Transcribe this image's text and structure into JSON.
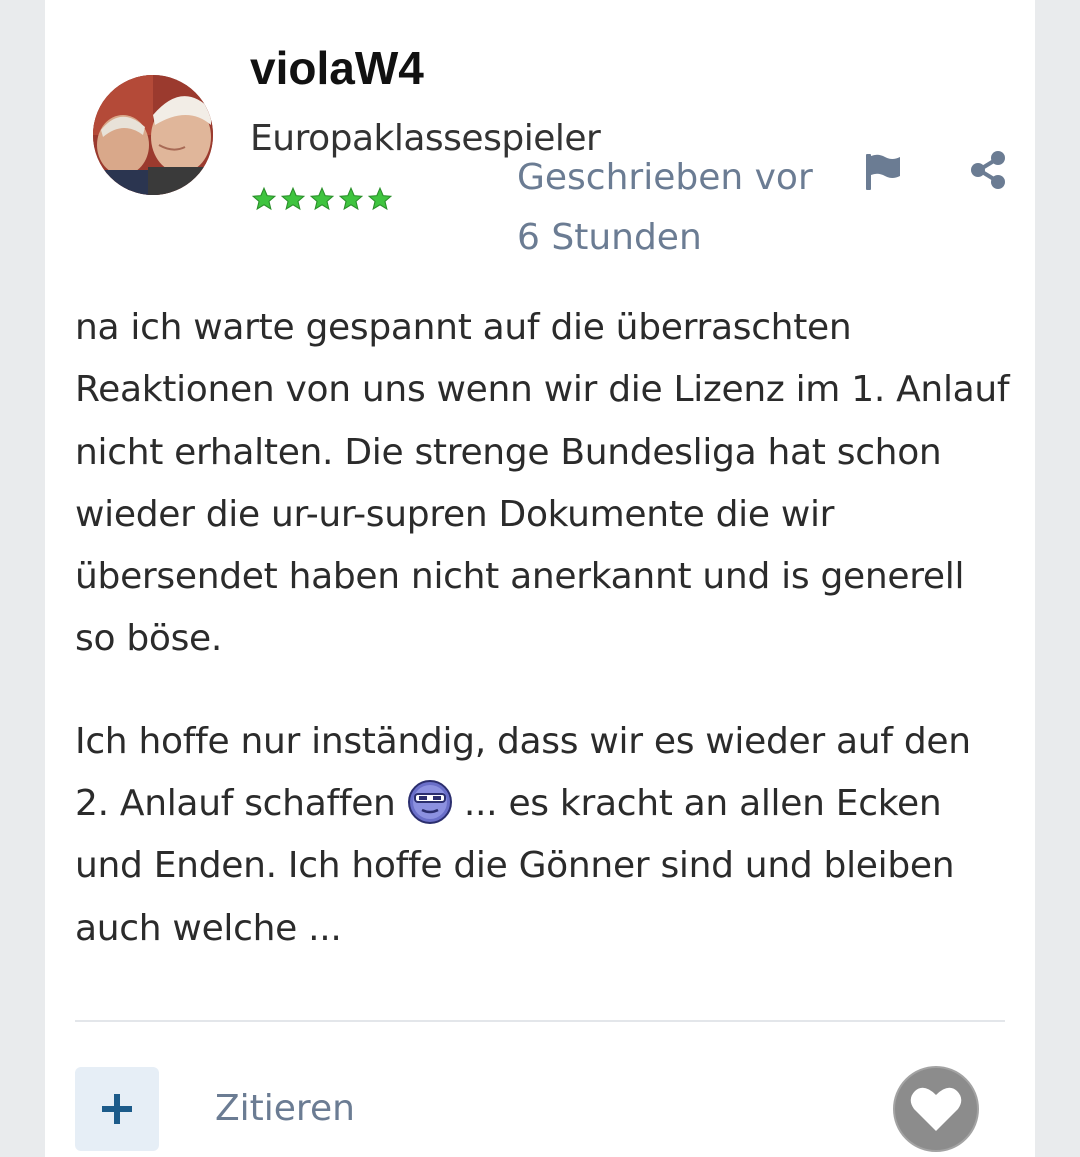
{
  "post": {
    "author": {
      "username": "violaW4",
      "rank": "Europaklassespieler",
      "stars": 5,
      "avatar_icon": "avatar-photo"
    },
    "posted_label": "Geschrieben vor",
    "posted_time": "6 Stunden",
    "actions": {
      "report_icon": "flag-icon",
      "share_icon": "share-icon"
    },
    "content": {
      "p1": "na ich warte gespannt auf die überraschten Reaktionen von uns wenn wir die Lizenz im 1. Anlauf nicht erhalten. Die strenge Bundesliga hat schon wieder die ur-ur-supren Dokumente die wir übersendet haben nicht anerkannt und is generell so böse.",
      "p2_before": "Ich hoffe nur inständig, dass wir es wieder auf den 2. Anlauf schaffen",
      "p2_after": " ... es kracht an allen Ecken und Enden. Ich hoffe die Gönner sind und bleiben auch welche ..."
    },
    "footer": {
      "multiquote_icon": "plus-icon",
      "quote_label": "Zitieren",
      "like_icon": "heart-icon"
    }
  },
  "colors": {
    "accent": "#1c5b8a",
    "meta": "#6b7c93",
    "stars": "#3fc43f",
    "like": "#8c8c8c"
  }
}
